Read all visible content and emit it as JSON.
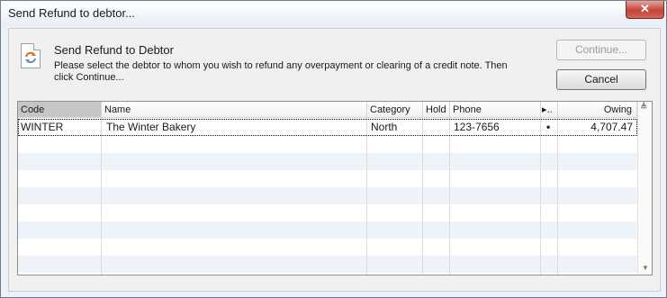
{
  "window": {
    "title": "Send Refund to debtor..."
  },
  "header": {
    "heading": "Send Refund to Debtor",
    "description": "Please select the debtor to whom you wish to refund any overpayment or clearing of a credit note. Then click Continue..."
  },
  "buttons": {
    "continue_label": "Continue...",
    "cancel_label": "Cancel"
  },
  "table": {
    "columns": [
      "Code",
      "Name",
      "Category",
      "Hold",
      "Phone",
      "▸..",
      "Owing"
    ],
    "rows": [
      {
        "code": "WINTER",
        "name": "The Winter Bakery",
        "category": "North",
        "hold": "",
        "phone": "123-7656",
        "flag": "•",
        "owing": "4,707.47"
      }
    ]
  },
  "icons": {
    "document": "refresh-document-icon",
    "close": "close-icon",
    "sort": "sort-arrow-icon"
  },
  "colors": {
    "stripe": "#eef3fa",
    "header_selected": "#c6c6c6",
    "close_button": "#c2453a"
  }
}
